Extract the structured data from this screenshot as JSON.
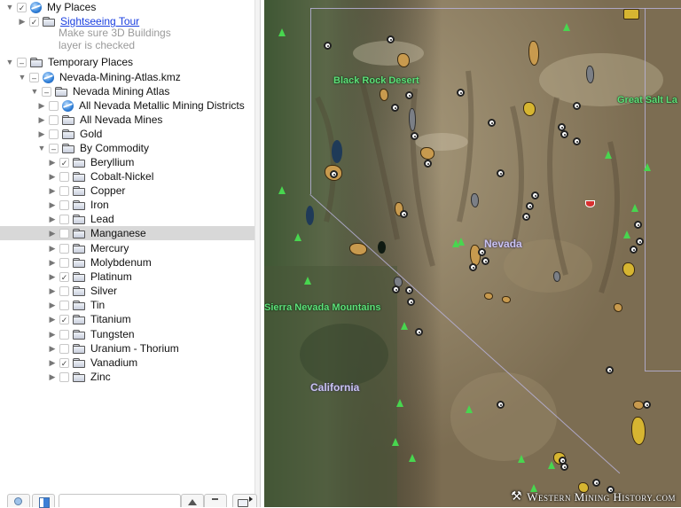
{
  "places_panel": {
    "tree": [
      {
        "label": "My Places",
        "icon": "globe-icon",
        "expanded": true,
        "checkbox": "checked",
        "level": 0
      },
      {
        "label": "Sightseeing Tour",
        "icon": "folder-icon",
        "expanded": false,
        "checkbox": "checked",
        "level": 1,
        "link": true,
        "description": [
          "Make sure 3D Buildings",
          "layer is checked"
        ]
      },
      {
        "label": "Temporary Places",
        "icon": "open-folder-icon",
        "expanded": true,
        "checkbox": "partial",
        "level": 0
      },
      {
        "label": "Nevada-Mining-Atlas.kmz",
        "icon": "globe-icon",
        "expanded": true,
        "checkbox": "partial",
        "level": 1
      },
      {
        "label": "Nevada Mining Atlas",
        "icon": "open-folder-icon",
        "expanded": true,
        "checkbox": "partial",
        "level": 2
      },
      {
        "label": "All Nevada Metallic Mining Districts",
        "icon": "globe-icon",
        "expanded": false,
        "checkbox": "unchecked",
        "level": 3
      },
      {
        "label": "All Nevada Mines",
        "icon": "folder-icon",
        "expanded": false,
        "checkbox": "unchecked",
        "level": 3
      },
      {
        "label": "Gold",
        "icon": "folder-icon",
        "expanded": false,
        "checkbox": "unchecked",
        "level": 3
      },
      {
        "label": "By Commodity",
        "icon": "open-folder-icon",
        "expanded": true,
        "checkbox": "partial",
        "level": 3
      },
      {
        "label": "Beryllium",
        "icon": "folder-icon",
        "expanded": false,
        "checkbox": "checked",
        "level": 4
      },
      {
        "label": "Cobalt-Nickel",
        "icon": "folder-icon",
        "expanded": false,
        "checkbox": "unchecked",
        "level": 4
      },
      {
        "label": "Copper",
        "icon": "folder-icon",
        "expanded": false,
        "checkbox": "unchecked",
        "level": 4
      },
      {
        "label": "Iron",
        "icon": "folder-icon",
        "expanded": false,
        "checkbox": "unchecked",
        "level": 4
      },
      {
        "label": "Lead",
        "icon": "folder-icon",
        "expanded": false,
        "checkbox": "unchecked",
        "level": 4
      },
      {
        "label": "Manganese",
        "icon": "folder-icon",
        "expanded": false,
        "checkbox": "unchecked",
        "level": 4,
        "selected": true
      },
      {
        "label": "Mercury",
        "icon": "folder-icon",
        "expanded": false,
        "checkbox": "unchecked",
        "level": 4
      },
      {
        "label": "Molybdenum",
        "icon": "folder-icon",
        "expanded": false,
        "checkbox": "unchecked",
        "level": 4
      },
      {
        "label": "Platinum",
        "icon": "folder-icon",
        "expanded": false,
        "checkbox": "checked",
        "level": 4
      },
      {
        "label": "Silver",
        "icon": "folder-icon",
        "expanded": false,
        "checkbox": "unchecked",
        "level": 4
      },
      {
        "label": "Tin",
        "icon": "folder-icon",
        "expanded": false,
        "checkbox": "unchecked",
        "level": 4
      },
      {
        "label": "Titanium",
        "icon": "folder-icon",
        "expanded": false,
        "checkbox": "checked",
        "level": 4
      },
      {
        "label": "Tungsten",
        "icon": "folder-icon",
        "expanded": false,
        "checkbox": "unchecked",
        "level": 4
      },
      {
        "label": "Uranium - Thorium",
        "icon": "folder-icon",
        "expanded": false,
        "checkbox": "unchecked",
        "level": 4
      },
      {
        "label": "Vanadium",
        "icon": "folder-icon",
        "expanded": false,
        "checkbox": "checked",
        "level": 4
      },
      {
        "label": "Zinc",
        "icon": "folder-icon",
        "expanded": false,
        "checkbox": "unchecked",
        "level": 4
      }
    ],
    "bottom_toolbar": {
      "search_button_icon": "search-icon",
      "panel_toggle_icon": "sidebar-icon",
      "search_input_value": "",
      "move_up_icon": "arrow-up-icon",
      "move_down_icon": "arrow-down-icon",
      "add_folder_icon": "add-folder-icon"
    }
  },
  "map": {
    "labels": {
      "black_rock_desert": "Black Rock Desert",
      "great_salt_lake": "Great Salt La",
      "nevada": "Nevada",
      "sierra_nevada": "Sierra Nevada Mountains",
      "california": "California"
    },
    "watermark": "Western Mining History.com",
    "colors": {
      "place_label": "#5fe07a",
      "state_label": "#c9c3f2",
      "district_fill": "#c89a4e",
      "highlight_fill": "#d6b531",
      "state_border": "#b7b2d8"
    }
  }
}
